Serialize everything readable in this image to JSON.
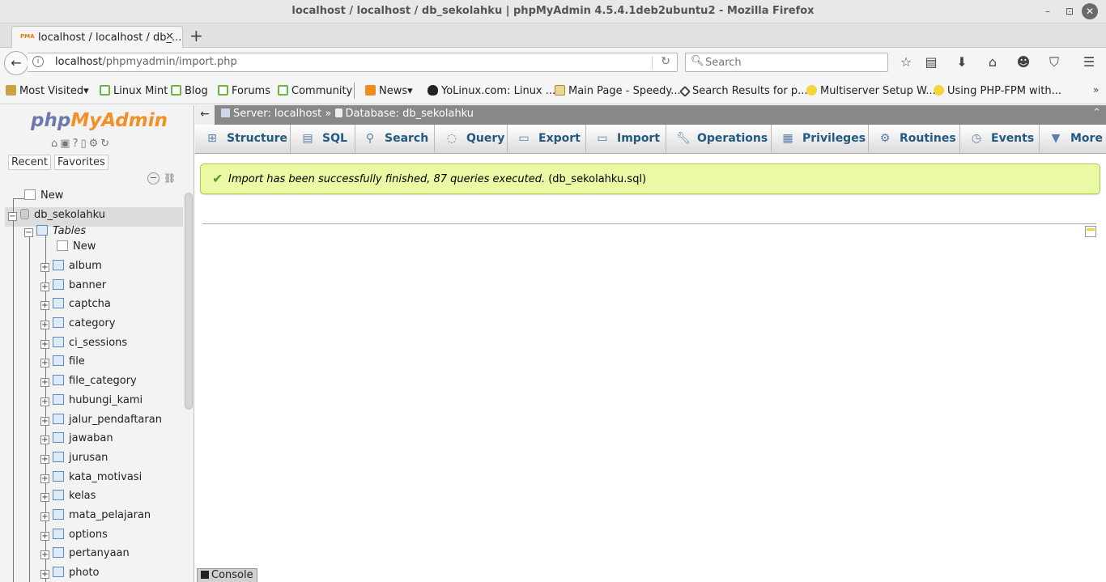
{
  "window": {
    "title": "localhost / localhost / db_sekolahku | phpMyAdmin 4.5.4.1deb2ubuntu2 - Mozilla Firefox",
    "min_glyph": "–",
    "max_glyph": "⊡",
    "close_glyph": "✕"
  },
  "tab": {
    "label": "localhost / localhost / db_...",
    "favicon_text": "PMA",
    "close_glyph": "✕",
    "new_tab_glyph": "+"
  },
  "nav": {
    "url_host": "localhost",
    "url_path": "/phpmyadmin/import.php",
    "search_placeholder": "Search",
    "back_glyph": "←",
    "reload_glyph": "↻",
    "toolbar_icons": [
      "star-icon",
      "reading-list-icon",
      "download-icon",
      "home-icon",
      "smiley-icon",
      "pocket-icon",
      "menu-icon"
    ]
  },
  "bookmarks": [
    {
      "label": "Most Visited",
      "icon": "folder",
      "dropdown": true
    },
    {
      "label": "Linux Mint",
      "icon": "mint"
    },
    {
      "label": "Blog",
      "icon": "mint"
    },
    {
      "label": "Forums",
      "icon": "mint"
    },
    {
      "label": "Community",
      "icon": "mint"
    },
    {
      "label": "News",
      "icon": "rss",
      "dropdown": true
    },
    {
      "label": "YoLinux.com: Linux ...",
      "icon": "tux"
    },
    {
      "label": "Main Page - Speedy...",
      "icon": "page"
    },
    {
      "label": "Search Results for p...",
      "icon": "hex"
    },
    {
      "label": "Multiserver Setup W...",
      "icon": "bulb"
    },
    {
      "label": "Using PHP-FPM with...",
      "icon": "bulb"
    }
  ],
  "left": {
    "logo_php": "php",
    "logo_ma": "MyAdmin",
    "recent_label": "Recent",
    "favorites_label": "Favorites",
    "tree": {
      "new_top": "New",
      "database": "db_sekolahku",
      "tables_label": "Tables",
      "new_table": "New",
      "tables": [
        "album",
        "banner",
        "captcha",
        "category",
        "ci_sessions",
        "file",
        "file_category",
        "hubungi_kami",
        "jalur_pendaftaran",
        "jawaban",
        "jurusan",
        "kata_motivasi",
        "kelas",
        "mata_pelajaran",
        "options",
        "pertanyaan",
        "photo"
      ]
    }
  },
  "breadcrumb": {
    "server": "Server: localhost",
    "separator": "»",
    "database": "Database: db_sekolahku"
  },
  "menu": [
    {
      "label": "Structure",
      "icon": "structure-icon"
    },
    {
      "label": "SQL",
      "icon": "sql-icon"
    },
    {
      "label": "Search",
      "icon": "search-icon"
    },
    {
      "label": "Query",
      "icon": "query-icon"
    },
    {
      "label": "Export",
      "icon": "export-icon"
    },
    {
      "label": "Import",
      "icon": "import-icon"
    },
    {
      "label": "Operations",
      "icon": "wrench-icon"
    },
    {
      "label": "Privileges",
      "icon": "privileges-icon"
    },
    {
      "label": "Routines",
      "icon": "routines-icon"
    },
    {
      "label": "Events",
      "icon": "clock-icon"
    },
    {
      "label": "More",
      "icon": "caret-down-icon"
    }
  ],
  "message": {
    "text": "Import has been successfully finished, 87 queries executed.",
    "file": "(db_sekolahku.sql)"
  },
  "console_label": "Console"
}
